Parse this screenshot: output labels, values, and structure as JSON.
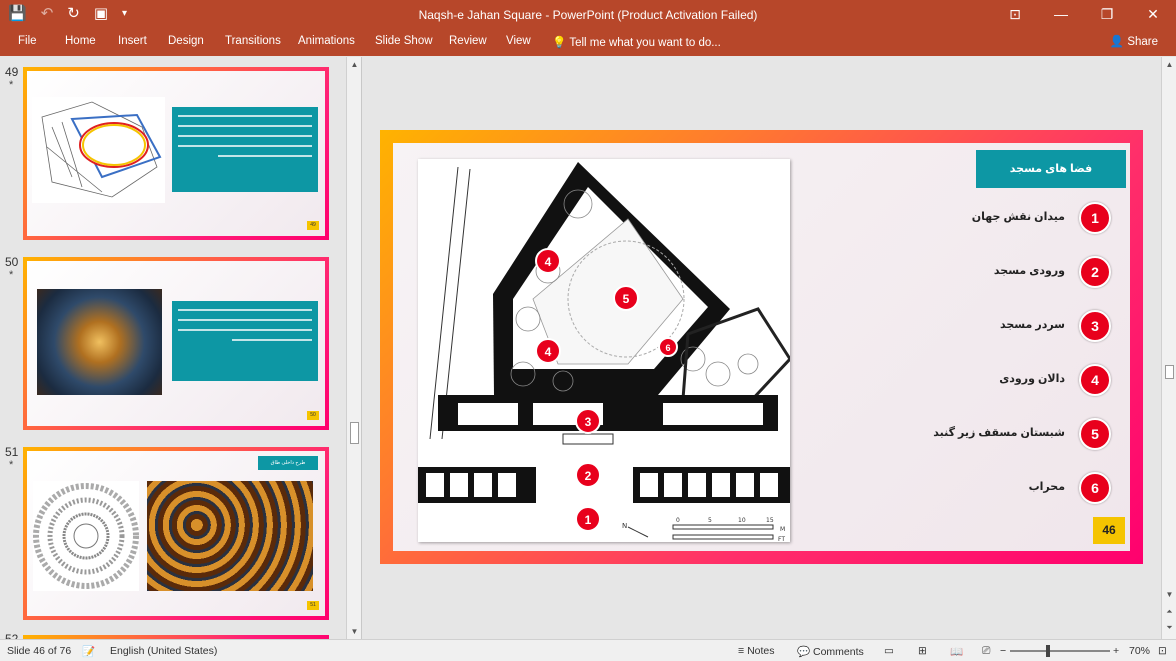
{
  "window": {
    "title": "Naqsh-e Jahan Square - PowerPoint (Product Activation Failed)",
    "controls": [
      "ribbon-display-icon",
      "minimize-icon",
      "restore-icon",
      "close-icon"
    ]
  },
  "ribbon": {
    "tabs": [
      "File",
      "Home",
      "Insert",
      "Design",
      "Transitions",
      "Animations",
      "Slide Show",
      "Review",
      "View"
    ],
    "tellme": "Tell me what you want to do...",
    "share": "Share"
  },
  "thumbnails": [
    {
      "number": "49",
      "star": "*",
      "badge": "49"
    },
    {
      "number": "50",
      "star": "*",
      "badge": "50"
    },
    {
      "number": "51",
      "star": "*",
      "badge": "51",
      "title_box": "طرح داخلی طاق"
    },
    {
      "number": "52",
      "star": "",
      "badge": ""
    }
  ],
  "slide": {
    "heading": "فضا های مسجد",
    "legend": [
      {
        "n": "1",
        "label": "میدان نقش جهان"
      },
      {
        "n": "2",
        "label": "ورودی مسجد"
      },
      {
        "n": "3",
        "label": "سردر مسجد"
      },
      {
        "n": "4",
        "label": "دالان ورودی"
      },
      {
        "n": "5",
        "label": "شبستان مسقف زیر گنبد"
      },
      {
        "n": "6",
        "label": "محراب"
      }
    ],
    "page_number": "46",
    "plan_markers": [
      "4",
      "5",
      "4",
      "6",
      "3",
      "2",
      "1"
    ],
    "plan_scale": {
      "north": "N",
      "unit_m": "M",
      "unit_ft": "FT",
      "scale_top": [
        "0",
        "5",
        "10",
        "15"
      ]
    }
  },
  "status": {
    "slide_info": "Slide 46 of 76",
    "language": "English (United States)",
    "notes": "Notes",
    "comments": "Comments",
    "zoom": "70%"
  },
  "colors": {
    "accent": "#b7472a",
    "teal": "#0d97a4",
    "marker": "#e8001c",
    "badge": "#f5c400"
  }
}
